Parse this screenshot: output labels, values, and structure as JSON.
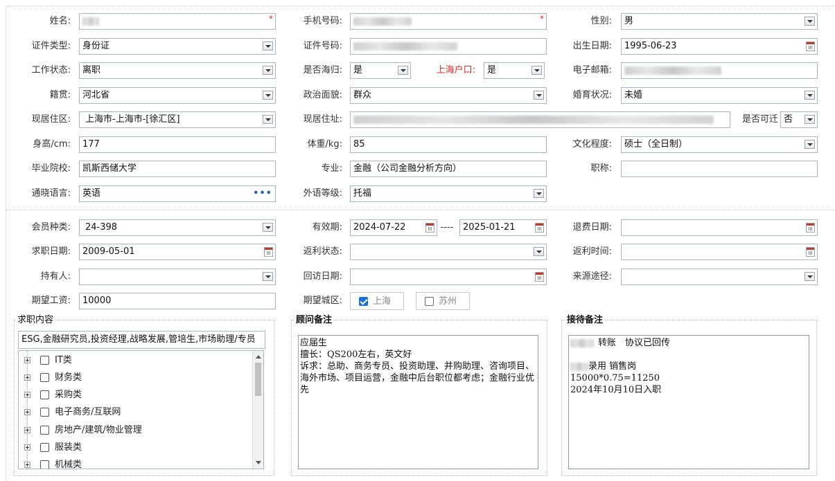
{
  "labels": {
    "name": "姓名:",
    "phone": "手机号码:",
    "gender": "性别:",
    "id_type": "证件类型:",
    "id_number": "证件号码:",
    "birth_date": "出生日期:",
    "work_status": "工作状态:",
    "returnee": "是否海归:",
    "shanghai_hukou": "上海户口:",
    "email": "电子邮箱:",
    "native_place": "籍贯:",
    "political_status": "政治面貌:",
    "marital_status": "婚育状况:",
    "residence_area": "现居住区:",
    "residence_address": "现居住址:",
    "relocate": "是否可迁",
    "height": "身高/cm:",
    "weight": "体重/kg:",
    "education": "文化程度:",
    "school": "毕业院校:",
    "major": "专业:",
    "title": "职称:",
    "languages": "通晓语言:",
    "language_level": "外语等级:",
    "member_type": "会员种类:",
    "valid_period": "有效期:",
    "refund_date": "退费日期:",
    "job_seek_date": "求职日期:",
    "rebate_status": "返利状态:",
    "rebate_time": "返利时间:",
    "holder": "持有人:",
    "revisit_date": "回访日期:",
    "source": "来源途径:",
    "expected_salary": "期望工资:",
    "expected_city": "期望城区:"
  },
  "values": {
    "gender": "男",
    "id_type": "身份证",
    "birth_date": "1995-06-23",
    "work_status": "离职",
    "returnee": "是",
    "shanghai_hukou": "是",
    "native_place": "河北省",
    "political_status": "群众",
    "marital_status": "未婚",
    "residence_area": "上海市-上海市-[徐汇区]",
    "relocate": "否",
    "height": "177",
    "weight": "85",
    "education": "硕士（全日制）",
    "school": "凯斯西储大学",
    "major": "金融（公司金融分析方向）",
    "title": "",
    "languages": "英语",
    "language_level": "托福",
    "member_type": "24-398",
    "valid_from": "2024-07-22",
    "valid_sep": "----",
    "valid_to": "2025-01-21",
    "refund_date": "",
    "job_seek_date": "2009-05-01",
    "rebate_status": "",
    "rebate_time": "",
    "holder": "",
    "revisit_date": "",
    "source": "",
    "expected_salary": "10000"
  },
  "required_mark": "*",
  "more_dots": "•••",
  "cities": [
    {
      "label": "上海",
      "checked": true
    },
    {
      "label": "苏州",
      "checked": false
    }
  ],
  "job_section": {
    "legend": "求职内容",
    "summary": "ESG,金融研究员,投资经理,战略发展,管培生,市场助理/专员",
    "categories": [
      "IT类",
      "财务类",
      "采购类",
      "电子商务/互联网",
      "房地产/建筑/物业管理",
      "服装类",
      "机械类"
    ]
  },
  "advisor_note": {
    "legend": "顾问备注",
    "lines": [
      "",
      "应届生",
      "擅长：QS200左右，英文好",
      "诉求：总助、商务专员、投资助理、并购助理、咨询项目、海外市场、项目运营，金融中后台职位都考虑；金融行业优先"
    ]
  },
  "reception_note": {
    "legend": "接待备注",
    "line1": "转账　协议已回传",
    "line2": "录用 销售岗",
    "line3": "15000*0.75=11250",
    "line4": "2024年10月10日入职"
  },
  "colors": {
    "border": "#a9b6c3",
    "required": "#d9281f",
    "check": "#1e6fd9"
  }
}
